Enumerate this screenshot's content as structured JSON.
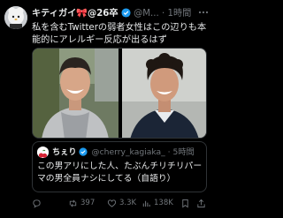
{
  "author": {
    "display_name": "キティガイ🎀@26卒",
    "handle": "@M...",
    "separator": "·",
    "time": "1時間"
  },
  "tweet_text": "私を含むTwitterの弱者女性はこの辺りも本能的にアレルギー反応が出るはず",
  "quoted": {
    "display_name": "ちぇり",
    "handle": "@cherry_kagiaka_",
    "separator": "·",
    "time": "5時間",
    "text": "この男アリにした人、たぶんチリチリパーマの男全員ナシにしてる（自語り）"
  },
  "actions": {
    "reply_count": "",
    "retweet_count": "397",
    "like_count": "3.3K",
    "views_count": "138K"
  },
  "icons": [
    "more-icon",
    "verified-icon",
    "reply-icon",
    "retweet-icon",
    "like-icon",
    "views-icon",
    "bookmark-icon",
    "share-icon"
  ],
  "colors": {
    "background": "#000000",
    "text": "#e7e9ea",
    "secondary_text": "#71767b",
    "verified": "#1d9bf0",
    "border": "#2f3336"
  }
}
